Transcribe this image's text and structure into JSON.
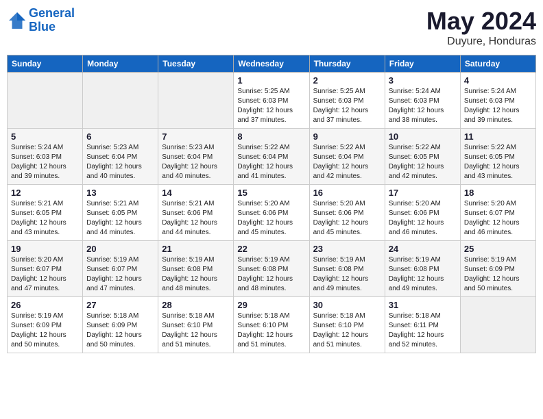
{
  "header": {
    "logo_line1": "General",
    "logo_line2": "Blue",
    "month": "May 2024",
    "location": "Duyure, Honduras"
  },
  "weekdays": [
    "Sunday",
    "Monday",
    "Tuesday",
    "Wednesday",
    "Thursday",
    "Friday",
    "Saturday"
  ],
  "weeks": [
    [
      {
        "day": "",
        "info": ""
      },
      {
        "day": "",
        "info": ""
      },
      {
        "day": "",
        "info": ""
      },
      {
        "day": "1",
        "info": "Sunrise: 5:25 AM\nSunset: 6:03 PM\nDaylight: 12 hours\nand 37 minutes."
      },
      {
        "day": "2",
        "info": "Sunrise: 5:25 AM\nSunset: 6:03 PM\nDaylight: 12 hours\nand 37 minutes."
      },
      {
        "day": "3",
        "info": "Sunrise: 5:24 AM\nSunset: 6:03 PM\nDaylight: 12 hours\nand 38 minutes."
      },
      {
        "day": "4",
        "info": "Sunrise: 5:24 AM\nSunset: 6:03 PM\nDaylight: 12 hours\nand 39 minutes."
      }
    ],
    [
      {
        "day": "5",
        "info": "Sunrise: 5:24 AM\nSunset: 6:03 PM\nDaylight: 12 hours\nand 39 minutes."
      },
      {
        "day": "6",
        "info": "Sunrise: 5:23 AM\nSunset: 6:04 PM\nDaylight: 12 hours\nand 40 minutes."
      },
      {
        "day": "7",
        "info": "Sunrise: 5:23 AM\nSunset: 6:04 PM\nDaylight: 12 hours\nand 40 minutes."
      },
      {
        "day": "8",
        "info": "Sunrise: 5:22 AM\nSunset: 6:04 PM\nDaylight: 12 hours\nand 41 minutes."
      },
      {
        "day": "9",
        "info": "Sunrise: 5:22 AM\nSunset: 6:04 PM\nDaylight: 12 hours\nand 42 minutes."
      },
      {
        "day": "10",
        "info": "Sunrise: 5:22 AM\nSunset: 6:05 PM\nDaylight: 12 hours\nand 42 minutes."
      },
      {
        "day": "11",
        "info": "Sunrise: 5:22 AM\nSunset: 6:05 PM\nDaylight: 12 hours\nand 43 minutes."
      }
    ],
    [
      {
        "day": "12",
        "info": "Sunrise: 5:21 AM\nSunset: 6:05 PM\nDaylight: 12 hours\nand 43 minutes."
      },
      {
        "day": "13",
        "info": "Sunrise: 5:21 AM\nSunset: 6:05 PM\nDaylight: 12 hours\nand 44 minutes."
      },
      {
        "day": "14",
        "info": "Sunrise: 5:21 AM\nSunset: 6:06 PM\nDaylight: 12 hours\nand 44 minutes."
      },
      {
        "day": "15",
        "info": "Sunrise: 5:20 AM\nSunset: 6:06 PM\nDaylight: 12 hours\nand 45 minutes."
      },
      {
        "day": "16",
        "info": "Sunrise: 5:20 AM\nSunset: 6:06 PM\nDaylight: 12 hours\nand 45 minutes."
      },
      {
        "day": "17",
        "info": "Sunrise: 5:20 AM\nSunset: 6:06 PM\nDaylight: 12 hours\nand 46 minutes."
      },
      {
        "day": "18",
        "info": "Sunrise: 5:20 AM\nSunset: 6:07 PM\nDaylight: 12 hours\nand 46 minutes."
      }
    ],
    [
      {
        "day": "19",
        "info": "Sunrise: 5:20 AM\nSunset: 6:07 PM\nDaylight: 12 hours\nand 47 minutes."
      },
      {
        "day": "20",
        "info": "Sunrise: 5:19 AM\nSunset: 6:07 PM\nDaylight: 12 hours\nand 47 minutes."
      },
      {
        "day": "21",
        "info": "Sunrise: 5:19 AM\nSunset: 6:08 PM\nDaylight: 12 hours\nand 48 minutes."
      },
      {
        "day": "22",
        "info": "Sunrise: 5:19 AM\nSunset: 6:08 PM\nDaylight: 12 hours\nand 48 minutes."
      },
      {
        "day": "23",
        "info": "Sunrise: 5:19 AM\nSunset: 6:08 PM\nDaylight: 12 hours\nand 49 minutes."
      },
      {
        "day": "24",
        "info": "Sunrise: 5:19 AM\nSunset: 6:08 PM\nDaylight: 12 hours\nand 49 minutes."
      },
      {
        "day": "25",
        "info": "Sunrise: 5:19 AM\nSunset: 6:09 PM\nDaylight: 12 hours\nand 50 minutes."
      }
    ],
    [
      {
        "day": "26",
        "info": "Sunrise: 5:19 AM\nSunset: 6:09 PM\nDaylight: 12 hours\nand 50 minutes."
      },
      {
        "day": "27",
        "info": "Sunrise: 5:18 AM\nSunset: 6:09 PM\nDaylight: 12 hours\nand 50 minutes."
      },
      {
        "day": "28",
        "info": "Sunrise: 5:18 AM\nSunset: 6:10 PM\nDaylight: 12 hours\nand 51 minutes."
      },
      {
        "day": "29",
        "info": "Sunrise: 5:18 AM\nSunset: 6:10 PM\nDaylight: 12 hours\nand 51 minutes."
      },
      {
        "day": "30",
        "info": "Sunrise: 5:18 AM\nSunset: 6:10 PM\nDaylight: 12 hours\nand 51 minutes."
      },
      {
        "day": "31",
        "info": "Sunrise: 5:18 AM\nSunset: 6:11 PM\nDaylight: 12 hours\nand 52 minutes."
      },
      {
        "day": "",
        "info": ""
      }
    ]
  ]
}
